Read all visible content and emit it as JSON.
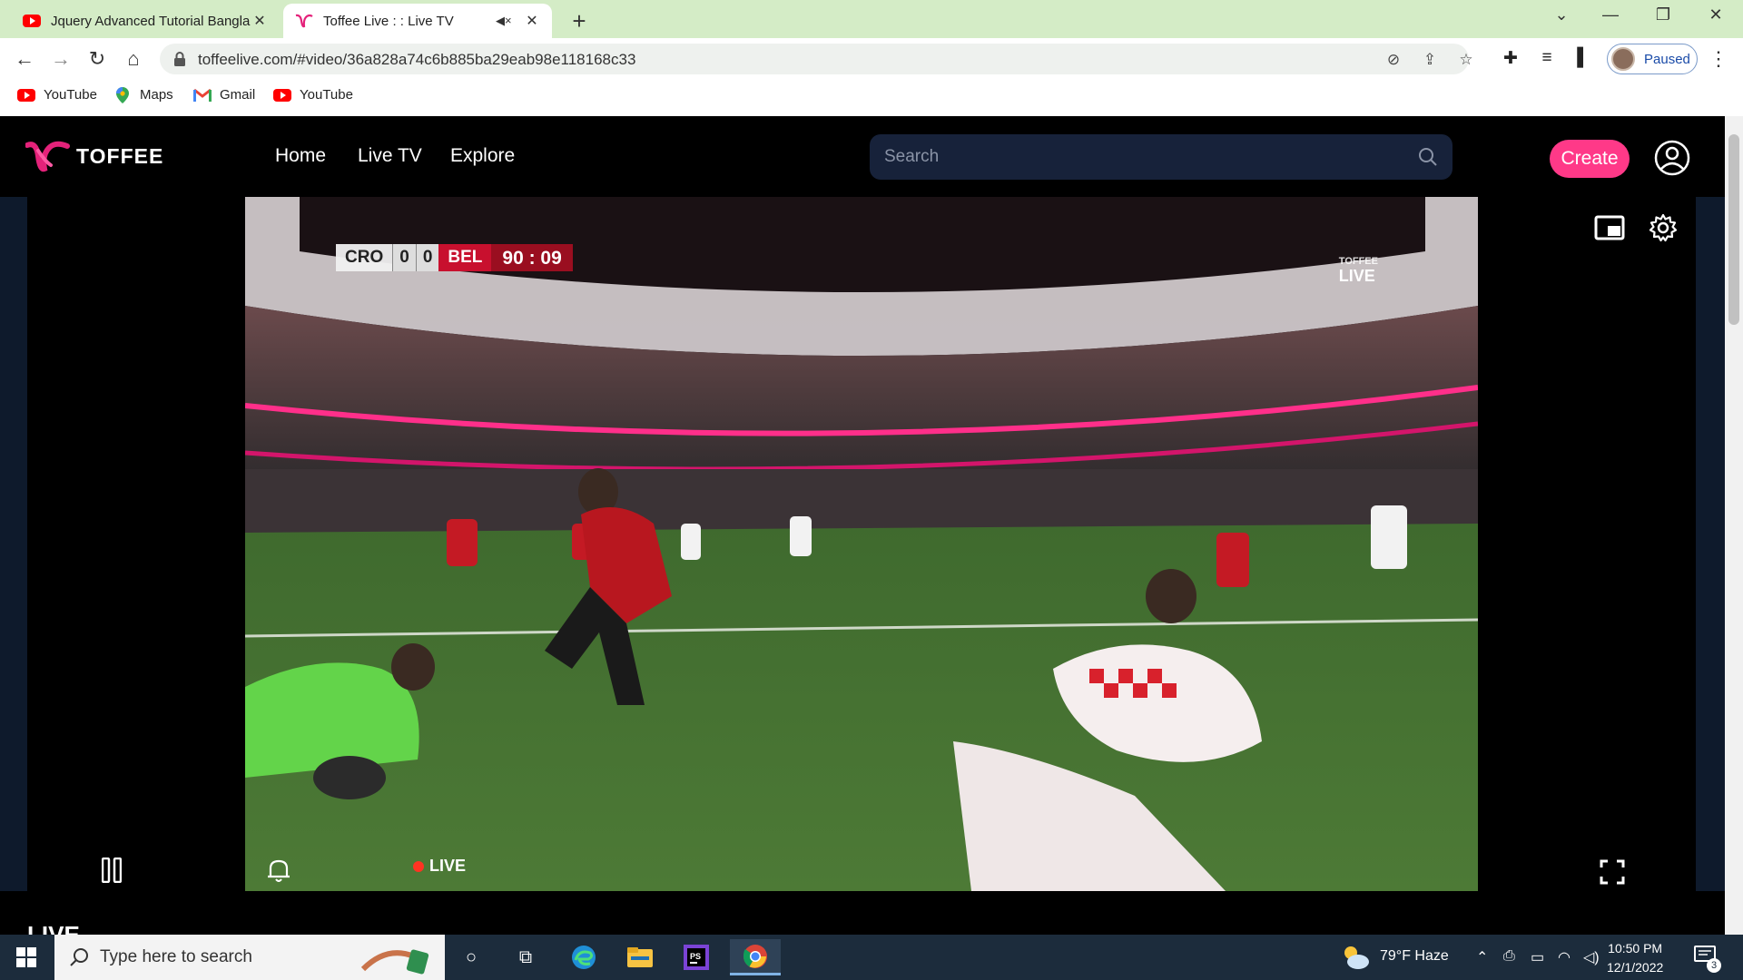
{
  "browser": {
    "tabs": [
      {
        "title": "Jquery Advanced Tutorial Bangla",
        "favicon": "youtube-icon",
        "active": false
      },
      {
        "title": "Toffee Live : : Live TV",
        "favicon": "toffee-icon",
        "active": true
      }
    ],
    "url": "toffeelive.com/#video/36a828a74c6b885ba29eab98e118168c33",
    "profile_label": "Paused",
    "bookmarks": [
      {
        "label": "YouTube",
        "icon": "youtube-icon"
      },
      {
        "label": "Maps",
        "icon": "maps-icon"
      },
      {
        "label": "Gmail",
        "icon": "gmail-icon"
      },
      {
        "label": "YouTube",
        "icon": "youtube-icon"
      }
    ]
  },
  "site": {
    "brand": "TOFFEE",
    "nav": [
      "Home",
      "Live TV",
      "Explore"
    ],
    "search_placeholder": "Search",
    "create_label": "Create",
    "accent": "#ff3988"
  },
  "player": {
    "scoreboard": {
      "home": "CRO",
      "home_score": "0",
      "away_score": "0",
      "away": "BEL",
      "clock": "90 : 09"
    },
    "watermark_live": "LIVE",
    "watermark_brand": "TOFFEE",
    "live_label": "LIVE",
    "state": "playing"
  },
  "below_player_heading": "LIVE",
  "taskbar": {
    "search_placeholder": "Type here to search",
    "weather": "79°F  Haze",
    "time": "10:50 PM",
    "date": "12/1/2022",
    "notification_count": "3"
  }
}
